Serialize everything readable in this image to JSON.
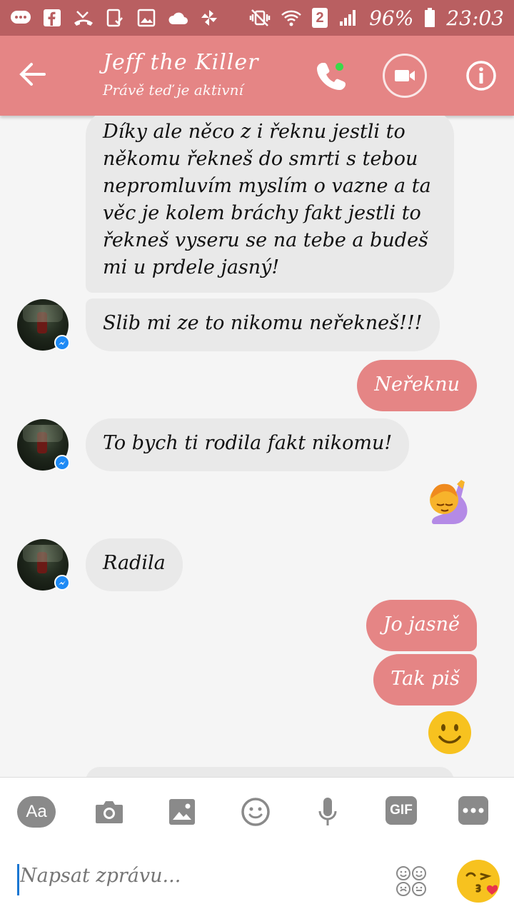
{
  "status_bar": {
    "sim_number": "2",
    "battery": "96%",
    "time": "23:03"
  },
  "header": {
    "title": "Jeff the Killer",
    "subtitle": "Právě teď je aktivní"
  },
  "messages": [
    {
      "side": "in",
      "text": "Díky ale něco z i řeknu jestli to někomu řekneš do smrti s tebou nepromluvím myslím o vazne a ta věc je kolem bráchy fakt jestli to řekneš vyseru se na tebe a budeš mi u prdele jasný!"
    },
    {
      "side": "in",
      "text": "Slib mi ze to nikomu neřekneš!!!"
    },
    {
      "side": "out",
      "text": "Neřeknu"
    },
    {
      "side": "in",
      "text": "To bych ti rodila fakt nikomu!"
    },
    {
      "side": "out",
      "emoji": "raising-hand-woman-emoji"
    },
    {
      "side": "in",
      "text": "Radila"
    },
    {
      "side": "out",
      "text": "Jo jasně"
    },
    {
      "side": "out",
      "text": "Tak piš"
    },
    {
      "side": "out",
      "emoji": "slightly-smiling-face-emoji"
    }
  ],
  "toolbar": {
    "aa_label": "Aa",
    "gif_label": "GIF",
    "icons": [
      "aa-icon",
      "camera-icon",
      "image-icon",
      "emoji-icon",
      "microphone-icon",
      "gif-icon",
      "more-icon"
    ]
  },
  "composer": {
    "placeholder": "Napsat zprávu..."
  },
  "colors": {
    "status_bar": "#b95f61",
    "header": "#e58585",
    "outgoing_bubble": "#e58585",
    "incoming_bubble": "#e9e9e9",
    "messenger_badge": "#1e8af5"
  }
}
